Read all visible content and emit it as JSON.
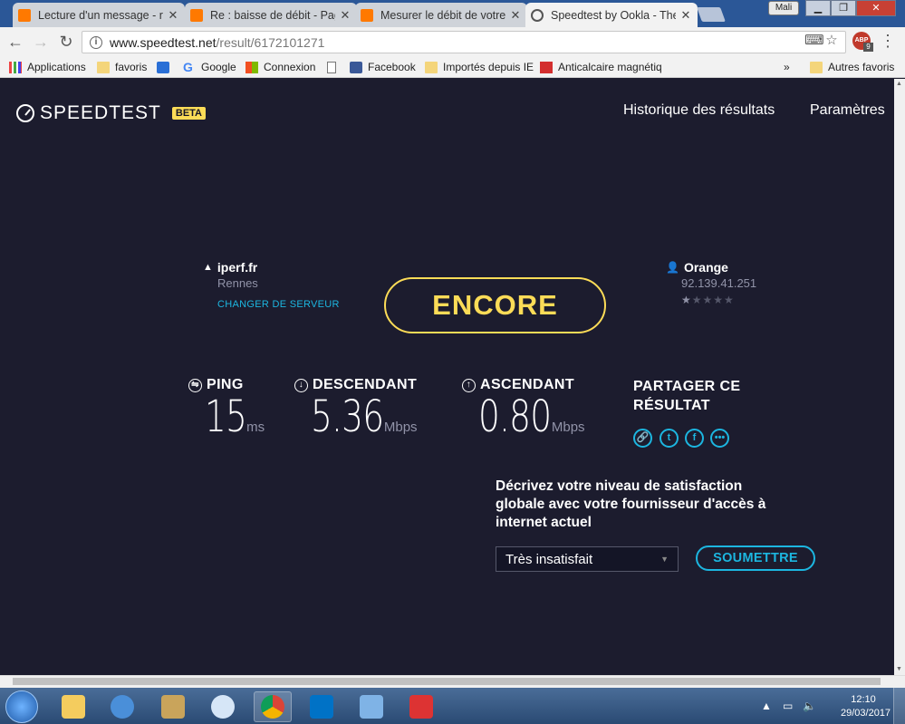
{
  "tabs": [
    {
      "title": "Lecture d'un message - r",
      "icon": "orange-icon"
    },
    {
      "title": "Re : baisse de débit - Pag",
      "icon": "orange-icon"
    },
    {
      "title": "Mesurer le débit de votre",
      "icon": "orange-icon"
    },
    {
      "title": "Speedtest by Ookla - The",
      "icon": "speedtest-icon",
      "active": true
    }
  ],
  "window": {
    "user_label": "Mali"
  },
  "omnibox": {
    "host": "www.speedtest.net",
    "path": "/result/6172101271"
  },
  "extensions": {
    "abp_label": "ABP",
    "abp_count": "9"
  },
  "bookmarks": {
    "items": [
      "Applications",
      "favoris",
      "Google",
      "Connexion",
      "",
      "Facebook",
      "Importés depuis IE",
      "Anticalcaire magnétiq"
    ],
    "overflow": "»",
    "other": "Autres favoris"
  },
  "speedtest": {
    "logo": "SPEEDTEST",
    "badge": "BETA",
    "nav": {
      "history": "Historique des résultats",
      "settings": "Paramètres"
    },
    "server": {
      "name": "iperf.fr",
      "city": "Rennes",
      "change": "CHANGER DE SERVEUR"
    },
    "isp": {
      "name": "Orange",
      "ip": "92.139.41.251",
      "rating_stars": "★★★★★",
      "rating": 1,
      "rating_max": 5
    },
    "go_label": "ENCORE",
    "ping": {
      "label": "PING",
      "value": "15",
      "unit": "ms"
    },
    "download": {
      "label": "DESCENDANT",
      "value": "5.36",
      "unit": "Mbps"
    },
    "upload": {
      "label": "ASCENDANT",
      "value": "0.80",
      "unit": "Mbps"
    },
    "share": {
      "label": "PARTAGER CE RÉSULTAT",
      "icons": [
        "link-icon",
        "twitter-icon",
        "facebook-icon",
        "more-icon"
      ]
    },
    "survey": {
      "question": "Décrivez votre niveau de satisfaction globale avec votre fournisseur d'accès à internet actuel",
      "selected": "Très insatisfait",
      "submit": "SOUMETTRE"
    }
  },
  "taskbar": {
    "time": "12:10",
    "date": "29/03/2017"
  },
  "colors": {
    "accent_yellow": "#fcdc57",
    "accent_cyan": "#1cb6e0",
    "background": "#1c1c2e"
  }
}
